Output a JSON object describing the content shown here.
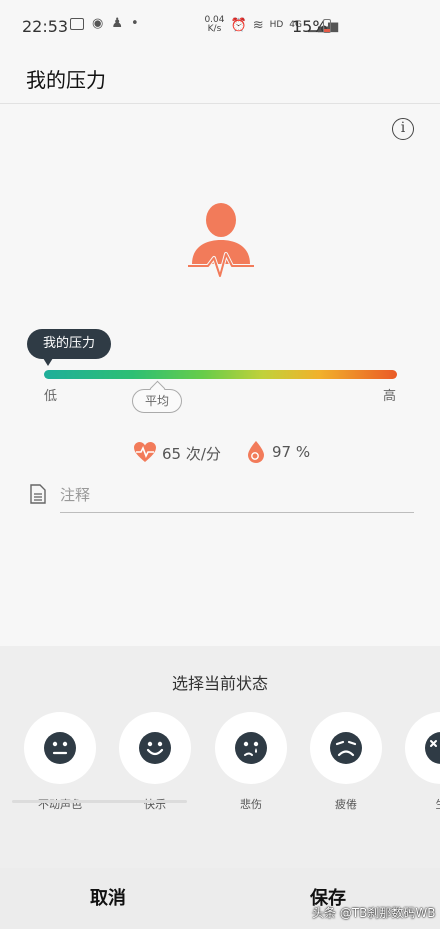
{
  "status_bar": {
    "time": "22:53",
    "net_speed_top": "0.04",
    "net_speed_bottom": "K/s",
    "hd": "HD",
    "signal": "4G",
    "battery": "15%"
  },
  "header": {
    "title": "我的压力"
  },
  "stress": {
    "tooltip": "我的压力",
    "low_label": "低",
    "high_label": "高",
    "average_label": "平均"
  },
  "stats": {
    "heart_rate": "65 次/分",
    "spo2": "97 %"
  },
  "note": {
    "placeholder": "注释"
  },
  "mood": {
    "title": "选择当前状态",
    "options": [
      {
        "label": "不动声色"
      },
      {
        "label": "快乐"
      },
      {
        "label": "悲伤"
      },
      {
        "label": "疲倦"
      },
      {
        "label": "生"
      }
    ]
  },
  "actions": {
    "cancel": "取消",
    "save": "保存"
  },
  "watermark": "头条 @TB刹那数码WB",
  "colors": {
    "accent_orange": "#f27b5a",
    "tooltip_bg": "#2f3b45",
    "face_dark": "#2f3b45"
  }
}
